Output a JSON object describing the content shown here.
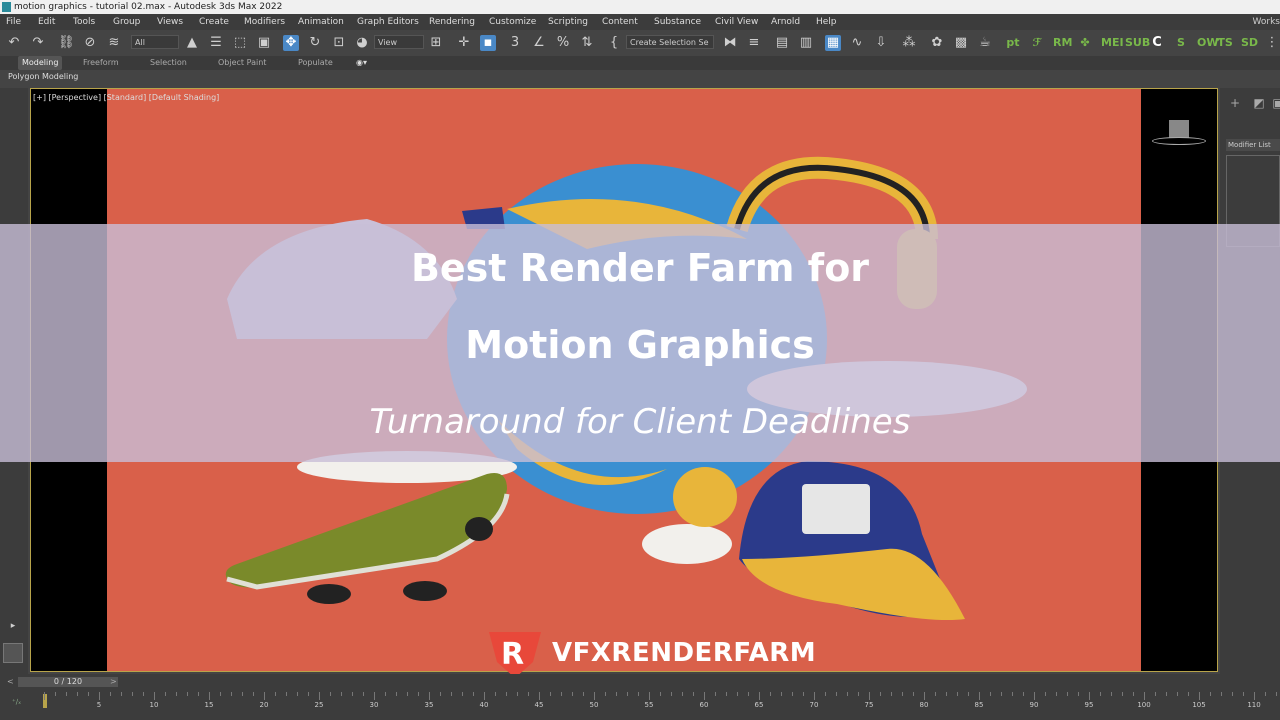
{
  "window": {
    "title": "motion graphics - tutorial 02.max - Autodesk 3ds Max 2022"
  },
  "menu": [
    "File",
    "Edit",
    "Tools",
    "Group",
    "Views",
    "Create",
    "Modifiers",
    "Animation",
    "Graph Editors",
    "Rendering",
    "Customize",
    "Scripting",
    "Content",
    "Substance",
    "Civil View",
    "Arnold",
    "Help"
  ],
  "workspaces_label": "Works",
  "toolbar": {
    "filter_value": "All",
    "refcoord_value": "View",
    "selection_set_placeholder": "Create Selection Se",
    "plugin_labels": [
      "pt",
      "RM",
      "MEI",
      "SUB",
      "OW",
      "SD"
    ]
  },
  "ribbon": {
    "tabs": [
      "Modeling",
      "Freeform",
      "Selection",
      "Object Paint",
      "Populate"
    ],
    "active_tab": "Modeling",
    "subtab": "Polygon Modeling"
  },
  "viewport": {
    "label": "[+] [Perspective] [Standard] [Default Shading]"
  },
  "command_panel": {
    "modifier_list": "Modifier List"
  },
  "overlay": {
    "headline_1": "Best Render Farm for",
    "headline_2": "Motion Graphics",
    "subline": "Turnaround for Client Deadlines",
    "brand": "VFXRENDERFARM",
    "brand_colors": {
      "logo_red": "#e8483a",
      "background": "#d9604a",
      "banner": "#c8bed7"
    }
  },
  "timeline": {
    "frame_readout": "0 / 120",
    "tick_labels": [
      "5",
      "10",
      "15",
      "20",
      "25",
      "30",
      "35",
      "40",
      "45",
      "50",
      "55",
      "60",
      "65",
      "70",
      "75",
      "80",
      "85",
      "90",
      "95",
      "100",
      "105",
      "110"
    ]
  }
}
